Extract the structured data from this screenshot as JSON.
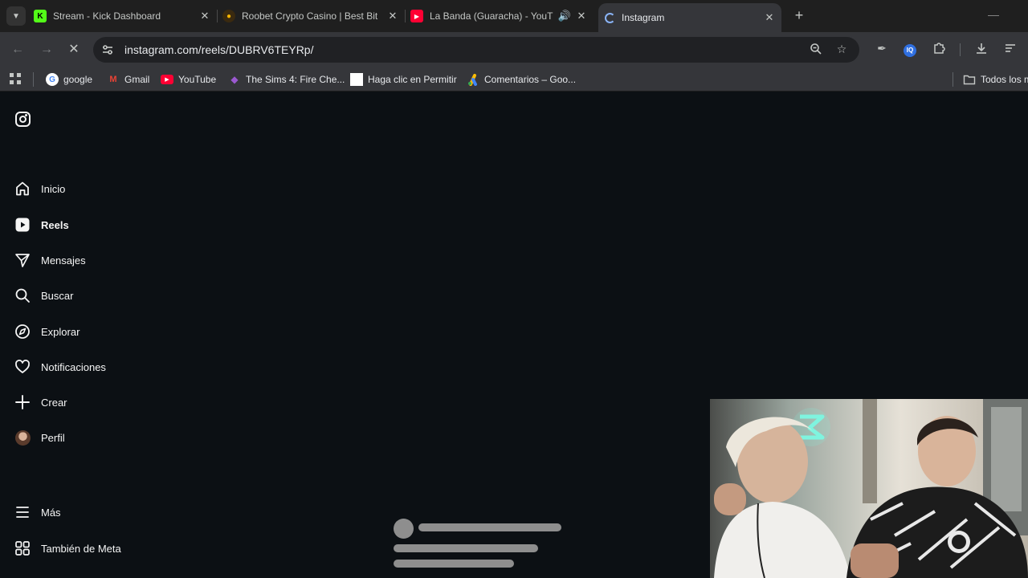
{
  "browser": {
    "tabs": [
      {
        "title": "Stream - Kick Dashboard",
        "icon": "kick-icon",
        "color": "#53fc18"
      },
      {
        "title": "Roobet Crypto Casino | Best Bit",
        "icon": "roobet-icon",
        "color": "#f5b400"
      },
      {
        "title": "La Banda (Guaracha) - YouT",
        "icon": "youtube-icon",
        "color": "#ff0033"
      },
      {
        "title": "Instagram",
        "icon": "loading-icon",
        "active": true
      }
    ],
    "url": "instagram.com/reels/DUBRV6TEYRp/",
    "bookmarks": [
      {
        "label": "google",
        "icon": "google-icon"
      },
      {
        "label": "Gmail",
        "icon": "gmail-icon"
      },
      {
        "label": "YouTube",
        "icon": "youtube-icon"
      },
      {
        "label": "The Sims 4: Fire Che...",
        "icon": "sims-icon"
      },
      {
        "label": "Haga clic en Permitir",
        "icon": "blank-page-icon"
      },
      {
        "label": "Comentarios – Goo...",
        "icon": "google-ads-icon"
      }
    ],
    "all_bookmarks": "Todos los m"
  },
  "instagram": {
    "nav": {
      "home": "Inicio",
      "reels": "Reels",
      "messages": "Mensajes",
      "search": "Buscar",
      "explore": "Explorar",
      "notifications": "Notificaciones",
      "create": "Crear",
      "profile": "Perfil",
      "more": "Más",
      "meta": "También de Meta"
    }
  },
  "colors": {
    "page_bg": "#0c1014",
    "chrome_bg": "#1f1f1f",
    "toolbar_bg": "#35363a",
    "text": "#f5f5f5",
    "skeleton": "#8e8e8e"
  }
}
